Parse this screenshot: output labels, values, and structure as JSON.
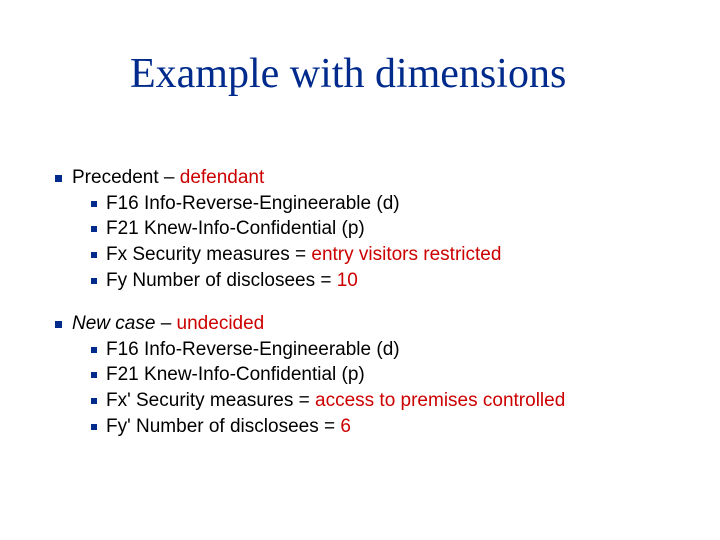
{
  "title": "Example with dimensions",
  "precedent": {
    "heading_a": "Precedent – ",
    "heading_b": "defendant",
    "items": [
      {
        "text": "F16 Info-Reverse-Engineerable (d)"
      },
      {
        "text": "F21 Knew-Info-Confidential (p)"
      },
      {
        "pre": "Fx Security measures = ",
        "red": "entry visitors restricted"
      },
      {
        "pre": "Fy Number of disclosees = ",
        "red": "10"
      }
    ]
  },
  "newcase": {
    "heading_a": "New case",
    "heading_b": " – ",
    "heading_c": "undecided",
    "items": [
      {
        "text": "F16 Info-Reverse-Engineerable (d)"
      },
      {
        "text": "F21 Knew-Info-Confidential (p)"
      },
      {
        "pre": "Fx' Security measures = ",
        "red": "access to premises controlled"
      },
      {
        "pre": "Fy' Number of disclosees = ",
        "red": "6"
      }
    ]
  }
}
